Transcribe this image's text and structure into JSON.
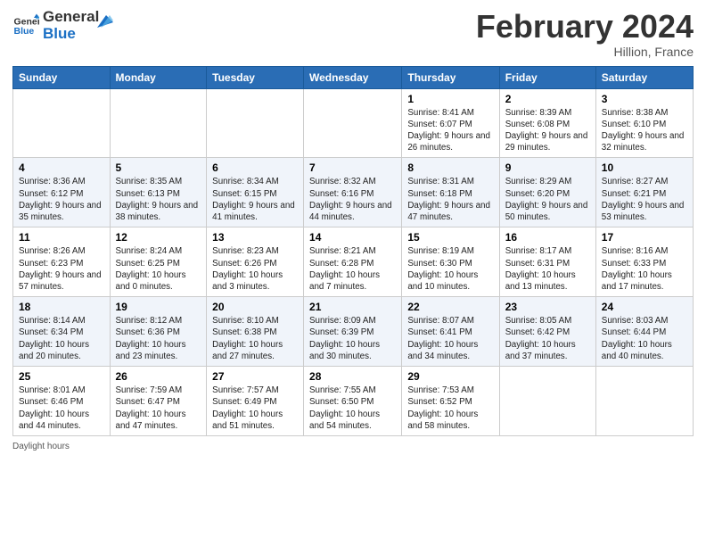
{
  "header": {
    "logo_line1": "General",
    "logo_line2": "Blue",
    "month_title": "February 2024",
    "location": "Hillion, France"
  },
  "days_of_week": [
    "Sunday",
    "Monday",
    "Tuesday",
    "Wednesday",
    "Thursday",
    "Friday",
    "Saturday"
  ],
  "weeks": [
    [
      {
        "num": "",
        "info": ""
      },
      {
        "num": "",
        "info": ""
      },
      {
        "num": "",
        "info": ""
      },
      {
        "num": "",
        "info": ""
      },
      {
        "num": "1",
        "info": "Sunrise: 8:41 AM\nSunset: 6:07 PM\nDaylight: 9 hours and 26 minutes."
      },
      {
        "num": "2",
        "info": "Sunrise: 8:39 AM\nSunset: 6:08 PM\nDaylight: 9 hours and 29 minutes."
      },
      {
        "num": "3",
        "info": "Sunrise: 8:38 AM\nSunset: 6:10 PM\nDaylight: 9 hours and 32 minutes."
      }
    ],
    [
      {
        "num": "4",
        "info": "Sunrise: 8:36 AM\nSunset: 6:12 PM\nDaylight: 9 hours and 35 minutes."
      },
      {
        "num": "5",
        "info": "Sunrise: 8:35 AM\nSunset: 6:13 PM\nDaylight: 9 hours and 38 minutes."
      },
      {
        "num": "6",
        "info": "Sunrise: 8:34 AM\nSunset: 6:15 PM\nDaylight: 9 hours and 41 minutes."
      },
      {
        "num": "7",
        "info": "Sunrise: 8:32 AM\nSunset: 6:16 PM\nDaylight: 9 hours and 44 minutes."
      },
      {
        "num": "8",
        "info": "Sunrise: 8:31 AM\nSunset: 6:18 PM\nDaylight: 9 hours and 47 minutes."
      },
      {
        "num": "9",
        "info": "Sunrise: 8:29 AM\nSunset: 6:20 PM\nDaylight: 9 hours and 50 minutes."
      },
      {
        "num": "10",
        "info": "Sunrise: 8:27 AM\nSunset: 6:21 PM\nDaylight: 9 hours and 53 minutes."
      }
    ],
    [
      {
        "num": "11",
        "info": "Sunrise: 8:26 AM\nSunset: 6:23 PM\nDaylight: 9 hours and 57 minutes."
      },
      {
        "num": "12",
        "info": "Sunrise: 8:24 AM\nSunset: 6:25 PM\nDaylight: 10 hours and 0 minutes."
      },
      {
        "num": "13",
        "info": "Sunrise: 8:23 AM\nSunset: 6:26 PM\nDaylight: 10 hours and 3 minutes."
      },
      {
        "num": "14",
        "info": "Sunrise: 8:21 AM\nSunset: 6:28 PM\nDaylight: 10 hours and 7 minutes."
      },
      {
        "num": "15",
        "info": "Sunrise: 8:19 AM\nSunset: 6:30 PM\nDaylight: 10 hours and 10 minutes."
      },
      {
        "num": "16",
        "info": "Sunrise: 8:17 AM\nSunset: 6:31 PM\nDaylight: 10 hours and 13 minutes."
      },
      {
        "num": "17",
        "info": "Sunrise: 8:16 AM\nSunset: 6:33 PM\nDaylight: 10 hours and 17 minutes."
      }
    ],
    [
      {
        "num": "18",
        "info": "Sunrise: 8:14 AM\nSunset: 6:34 PM\nDaylight: 10 hours and 20 minutes."
      },
      {
        "num": "19",
        "info": "Sunrise: 8:12 AM\nSunset: 6:36 PM\nDaylight: 10 hours and 23 minutes."
      },
      {
        "num": "20",
        "info": "Sunrise: 8:10 AM\nSunset: 6:38 PM\nDaylight: 10 hours and 27 minutes."
      },
      {
        "num": "21",
        "info": "Sunrise: 8:09 AM\nSunset: 6:39 PM\nDaylight: 10 hours and 30 minutes."
      },
      {
        "num": "22",
        "info": "Sunrise: 8:07 AM\nSunset: 6:41 PM\nDaylight: 10 hours and 34 minutes."
      },
      {
        "num": "23",
        "info": "Sunrise: 8:05 AM\nSunset: 6:42 PM\nDaylight: 10 hours and 37 minutes."
      },
      {
        "num": "24",
        "info": "Sunrise: 8:03 AM\nSunset: 6:44 PM\nDaylight: 10 hours and 40 minutes."
      }
    ],
    [
      {
        "num": "25",
        "info": "Sunrise: 8:01 AM\nSunset: 6:46 PM\nDaylight: 10 hours and 44 minutes."
      },
      {
        "num": "26",
        "info": "Sunrise: 7:59 AM\nSunset: 6:47 PM\nDaylight: 10 hours and 47 minutes."
      },
      {
        "num": "27",
        "info": "Sunrise: 7:57 AM\nSunset: 6:49 PM\nDaylight: 10 hours and 51 minutes."
      },
      {
        "num": "28",
        "info": "Sunrise: 7:55 AM\nSunset: 6:50 PM\nDaylight: 10 hours and 54 minutes."
      },
      {
        "num": "29",
        "info": "Sunrise: 7:53 AM\nSunset: 6:52 PM\nDaylight: 10 hours and 58 minutes."
      },
      {
        "num": "",
        "info": ""
      },
      {
        "num": "",
        "info": ""
      }
    ]
  ],
  "footer": {
    "label": "Daylight hours"
  }
}
